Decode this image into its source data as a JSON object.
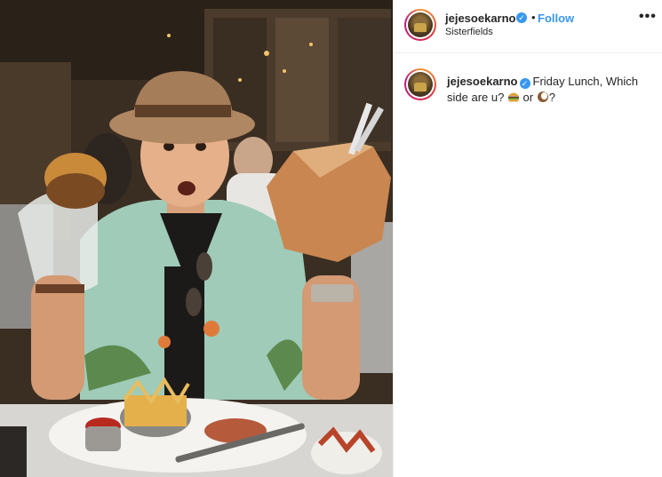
{
  "post": {
    "photo_alt": "Photo"
  },
  "header": {
    "username": "jejesoekarno",
    "verified_glyph": "✓",
    "separator": "•",
    "follow_label": "Follow",
    "location": "Sisterfields",
    "more_label": "•••"
  },
  "caption": {
    "username": "jejesoekarno",
    "verified_glyph": "✓",
    "text_part1": "Friday Lunch, Which side are u? ",
    "emoji_1": "burger-emoji",
    "text_part2": " or ",
    "emoji_2": "coconut-emoji",
    "text_part3": "?"
  },
  "colors": {
    "accent_blue": "#3897f0",
    "text": "#262626",
    "border": "#efefef"
  }
}
